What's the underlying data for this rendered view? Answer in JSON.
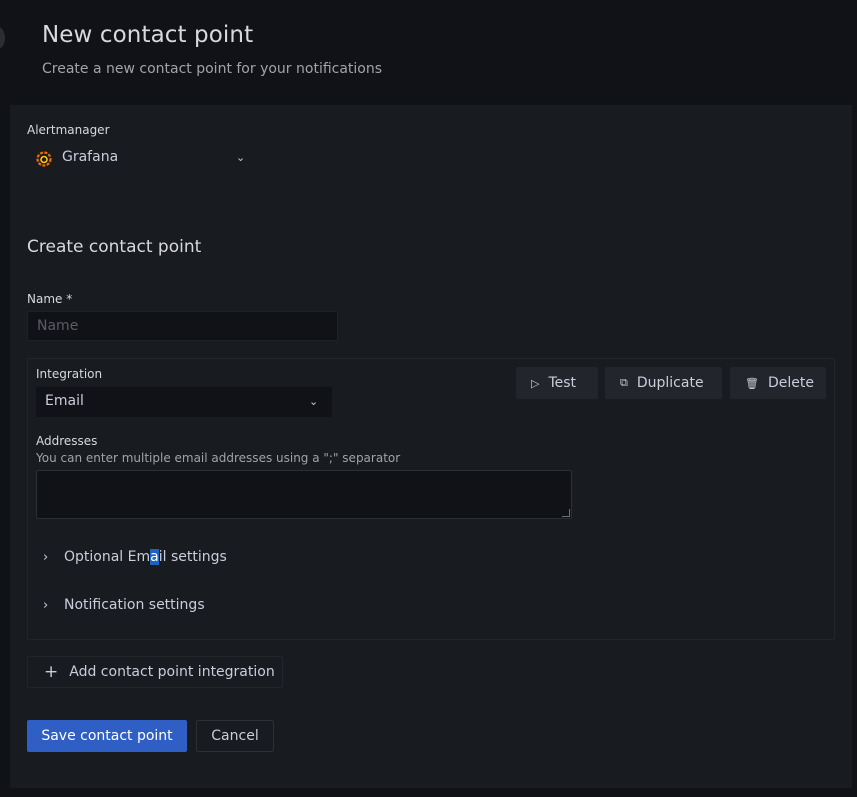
{
  "header": {
    "title": "New contact point",
    "subtitle": "Create a new contact point for your notifications"
  },
  "alertmanager": {
    "label": "Alertmanager",
    "selected": "Grafana",
    "logo_icon": "grafana-logo-icon"
  },
  "form": {
    "section_title": "Create contact point",
    "name_label": "Name *",
    "name_placeholder": "Name",
    "name_value": ""
  },
  "integration": {
    "label": "Integration",
    "selected": "Email",
    "buttons": {
      "test": "Test",
      "duplicate": "Duplicate",
      "delete": "Delete"
    },
    "addresses_label": "Addresses",
    "addresses_hint": "You can enter multiple email addresses using a \";\" separator",
    "addresses_value": "",
    "collapsibles": [
      {
        "label_pre": "Optional Em",
        "label_hl": "a",
        "label_post": "il settings"
      },
      {
        "label": "Notification settings"
      }
    ]
  },
  "actions": {
    "add_integration": "Add contact point integration",
    "save": "Save contact point",
    "cancel": "Cancel"
  },
  "colors": {
    "primary": "#2f5fc4",
    "background": "#111217",
    "panel": "#181b1f",
    "grafana_orange": "#f46800"
  }
}
